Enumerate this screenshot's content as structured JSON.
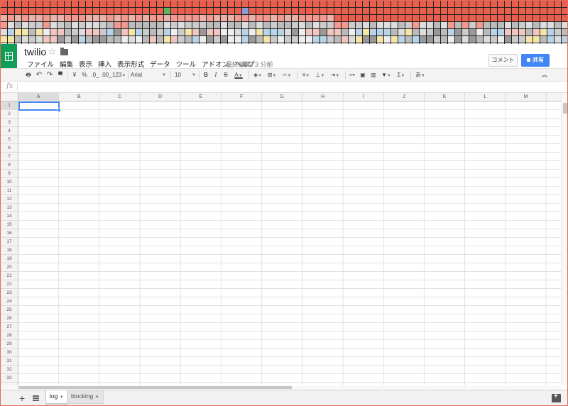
{
  "header": {
    "doc_title": "twilio",
    "last_edit": "最終編集: 3 分前",
    "comment_label": "コメント",
    "share_label": "共有",
    "menu": [
      "ファイル",
      "編集",
      "表示",
      "挿入",
      "表示形式",
      "データ",
      "ツール",
      "アドオン",
      "ヘルプ"
    ]
  },
  "toolbar": {
    "currency": "¥",
    "percent": "%",
    "dec_less": ".0_",
    "dec_more": ".00_",
    "more_formats": "123",
    "font": "Arial",
    "font_size": "10",
    "bold": "B",
    "italic": "I",
    "strike": "S",
    "text_color": "A",
    "sum": "Σ",
    "input_tools": "あ"
  },
  "formula_bar": {
    "fx": "fx"
  },
  "grid": {
    "columns": [
      "A",
      "B",
      "C",
      "D",
      "E",
      "F",
      "G",
      "H",
      "I",
      "J",
      "K",
      "L",
      "M"
    ],
    "rows": [
      "1",
      "2",
      "3",
      "4",
      "5",
      "6",
      "7",
      "8",
      "9",
      "10",
      "11",
      "12",
      "13",
      "14",
      "15",
      "16",
      "17",
      "18",
      "19",
      "20",
      "21",
      "22",
      "23",
      "24",
      "25",
      "26",
      "27",
      "28",
      "29",
      "30",
      "31",
      "32",
      "33"
    ],
    "selected_cell": "A1"
  },
  "sheets": {
    "tabs": [
      "log",
      "blocking"
    ],
    "active": "log"
  },
  "colors": {
    "brand_green": "#0f9d58",
    "share_blue": "#4285f4",
    "strip_red": "#e8604d",
    "strip_salmon": "#f29a8f"
  }
}
